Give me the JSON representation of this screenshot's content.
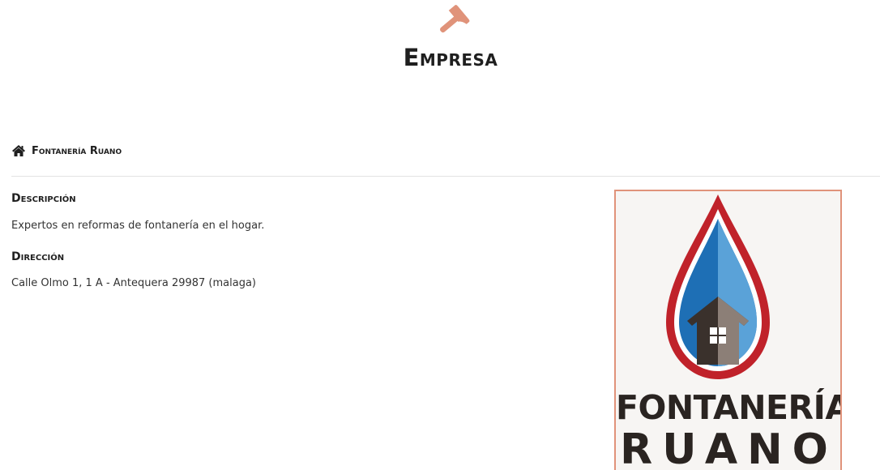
{
  "header": {
    "icon": "hammer-icon",
    "title": "Empresa"
  },
  "company": {
    "icon": "house-icon",
    "name": "Fontanería Ruano"
  },
  "description": {
    "label": "Descripción",
    "text": "Expertos en reformas de fontanería en el hogar."
  },
  "address": {
    "label": "Dirección",
    "text": "Calle Olmo 1, 1 A - Antequera 29987 (malaga)"
  },
  "logo": {
    "line1": "FONTANERÍA",
    "line2": "RUANO"
  },
  "colors": {
    "accent": "#e0937a",
    "drop_red": "#c0222a",
    "drop_blue": "#1e6fb5",
    "house_dark": "#3a312c"
  }
}
